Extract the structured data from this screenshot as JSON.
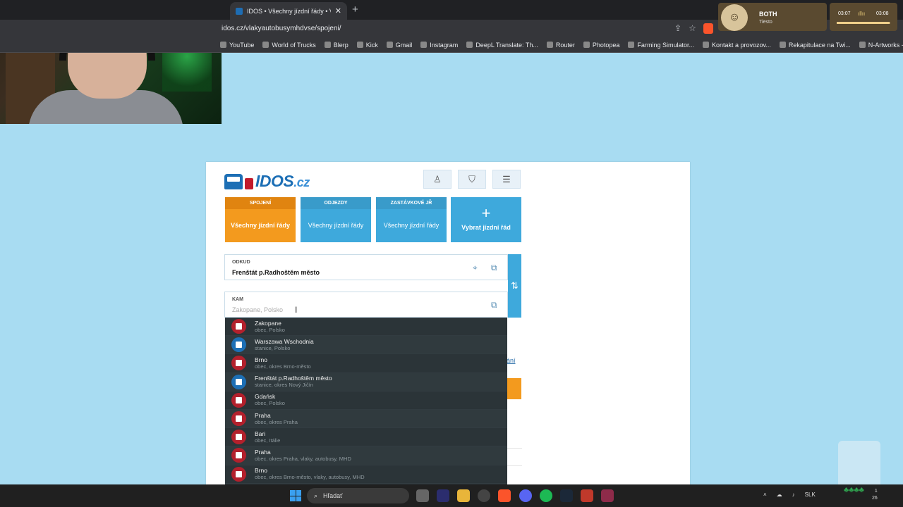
{
  "browser": {
    "tab_title": "IDOS • Všechny jízdní řády • Vyh",
    "new_tab": "+",
    "close": "✕",
    "url": "idos.cz/vlakyautobusymhdvse/spojeni/",
    "bookmarks": [
      "YouTube",
      "World of Trucks",
      "Blerp",
      "Kick",
      "Gmail",
      "Instagram",
      "DeepL Translate: Th...",
      "Router",
      "Photopea",
      "Farming Simulator...",
      "Kontakt a provozov...",
      "Rekapitulace na Twi...",
      "N-Artworks - PNG"
    ]
  },
  "now_playing": {
    "artist": "BOTH",
    "subtitle": "Tiësto",
    "elapsed": "03:07",
    "total": "03:08",
    "progress": 0.99
  },
  "idos": {
    "logo_main": "IDOS",
    "logo_tld": ".cz",
    "tiles": [
      {
        "head": "SPOJENÍ",
        "body": "Všechny jízdní řády"
      },
      {
        "head": "ODJEZDY",
        "body": "Všechny jízdní řády"
      },
      {
        "head": "ZASTÁVKOVÉ JŘ",
        "body": "Všechny jízdní řády"
      }
    ],
    "plus_tile": {
      "mark": "+",
      "body": "Vybrat jízdní řád"
    },
    "from": {
      "label": "ODKUD",
      "value": "Frenštát p.Radhoštěm město"
    },
    "to": {
      "label": "KAM",
      "placeholder": "Zakopane, Polsko"
    },
    "swap_icon": "⇅",
    "link_fragment": "ání",
    "suggestions": [
      {
        "name": "Zakopane",
        "desc": "obec, Polsko",
        "kind": "city"
      },
      {
        "name": "Warszawa Wschodnia",
        "desc": "stanice, Polsko",
        "kind": "station"
      },
      {
        "name": "Brno",
        "desc": "obec, okres Brno-město",
        "kind": "city"
      },
      {
        "name": "Frenštát p.Radhoštěm město",
        "desc": "stanice, okres Nový Jičín",
        "kind": "station"
      },
      {
        "name": "Gdańsk",
        "desc": "obec, Polsko",
        "kind": "city"
      },
      {
        "name": "Praha",
        "desc": "obec, okres Praha",
        "kind": "city"
      },
      {
        "name": "Bari",
        "desc": "obec, Itálie",
        "kind": "city"
      },
      {
        "name": "Praha",
        "desc": "obec, okres Praha, vlaky, autobusy, MHD",
        "kind": "city"
      },
      {
        "name": "Brno",
        "desc": "obec, okres Brno-město, vlaky, autobusy, MHD",
        "kind": "city"
      }
    ]
  },
  "taskbar": {
    "search_placeholder": "Hľadať",
    "lang": "SLK",
    "time_partial": "1",
    "date_partial": "26"
  },
  "colors": {
    "page_bg": "#a8dcf2",
    "tile_blue": "#3ea9dc",
    "tile_orange": "#f39a1e",
    "dropdown_bg": "#2b3438",
    "city_red": "#b3202c",
    "station_blue": "#1d6fb5"
  }
}
